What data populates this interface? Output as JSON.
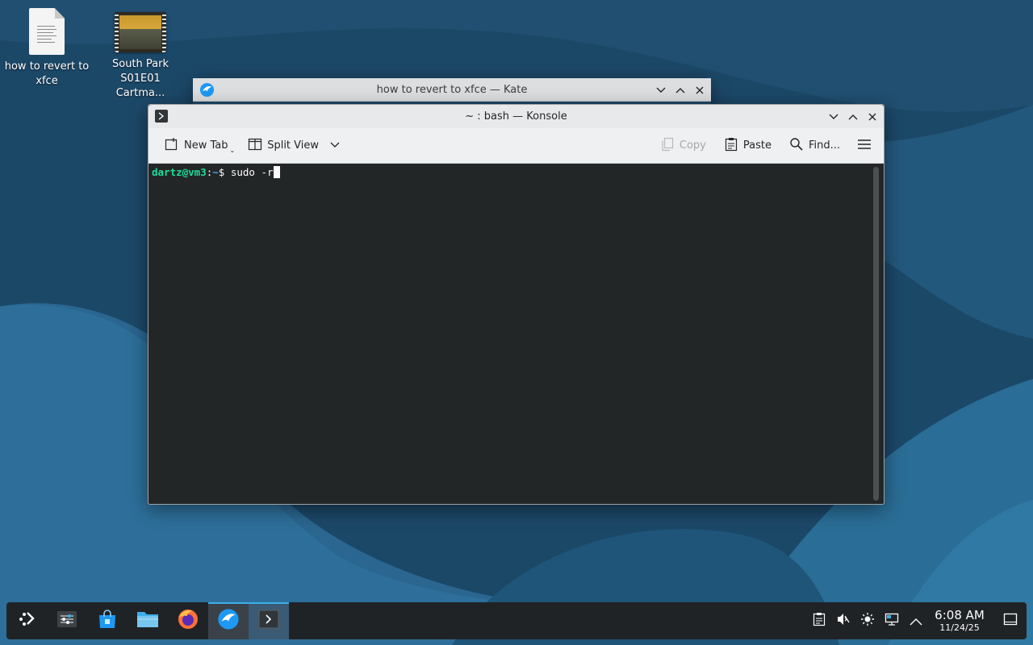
{
  "desktop": {
    "icons": [
      {
        "label": "how to revert to xfce",
        "icon": "text-document-icon"
      },
      {
        "label": "South Park S01E01 Cartma...",
        "icon": "video-thumbnail-icon"
      }
    ]
  },
  "kate_window": {
    "title": "how to revert to xfce — Kate"
  },
  "konsole_window": {
    "title": "~ : bash — Konsole",
    "toolbar": {
      "new_tab": "New Tab",
      "split_view": "Split View",
      "copy": "Copy",
      "paste": "Paste",
      "find": "Find..."
    },
    "terminal": {
      "user_host": "dartz@vm3",
      "separator": ":",
      "path": "~",
      "prompt_symbol": "$",
      "command": "sudo -r"
    }
  },
  "taskbar": {
    "clock": {
      "time": "6:08 AM",
      "date": "11/24/25"
    }
  },
  "colors": {
    "accent": "#3daee9",
    "prompt_user": "#1cdc9a",
    "terminal_bg": "#232627",
    "taskbar_bg": "#202326"
  }
}
